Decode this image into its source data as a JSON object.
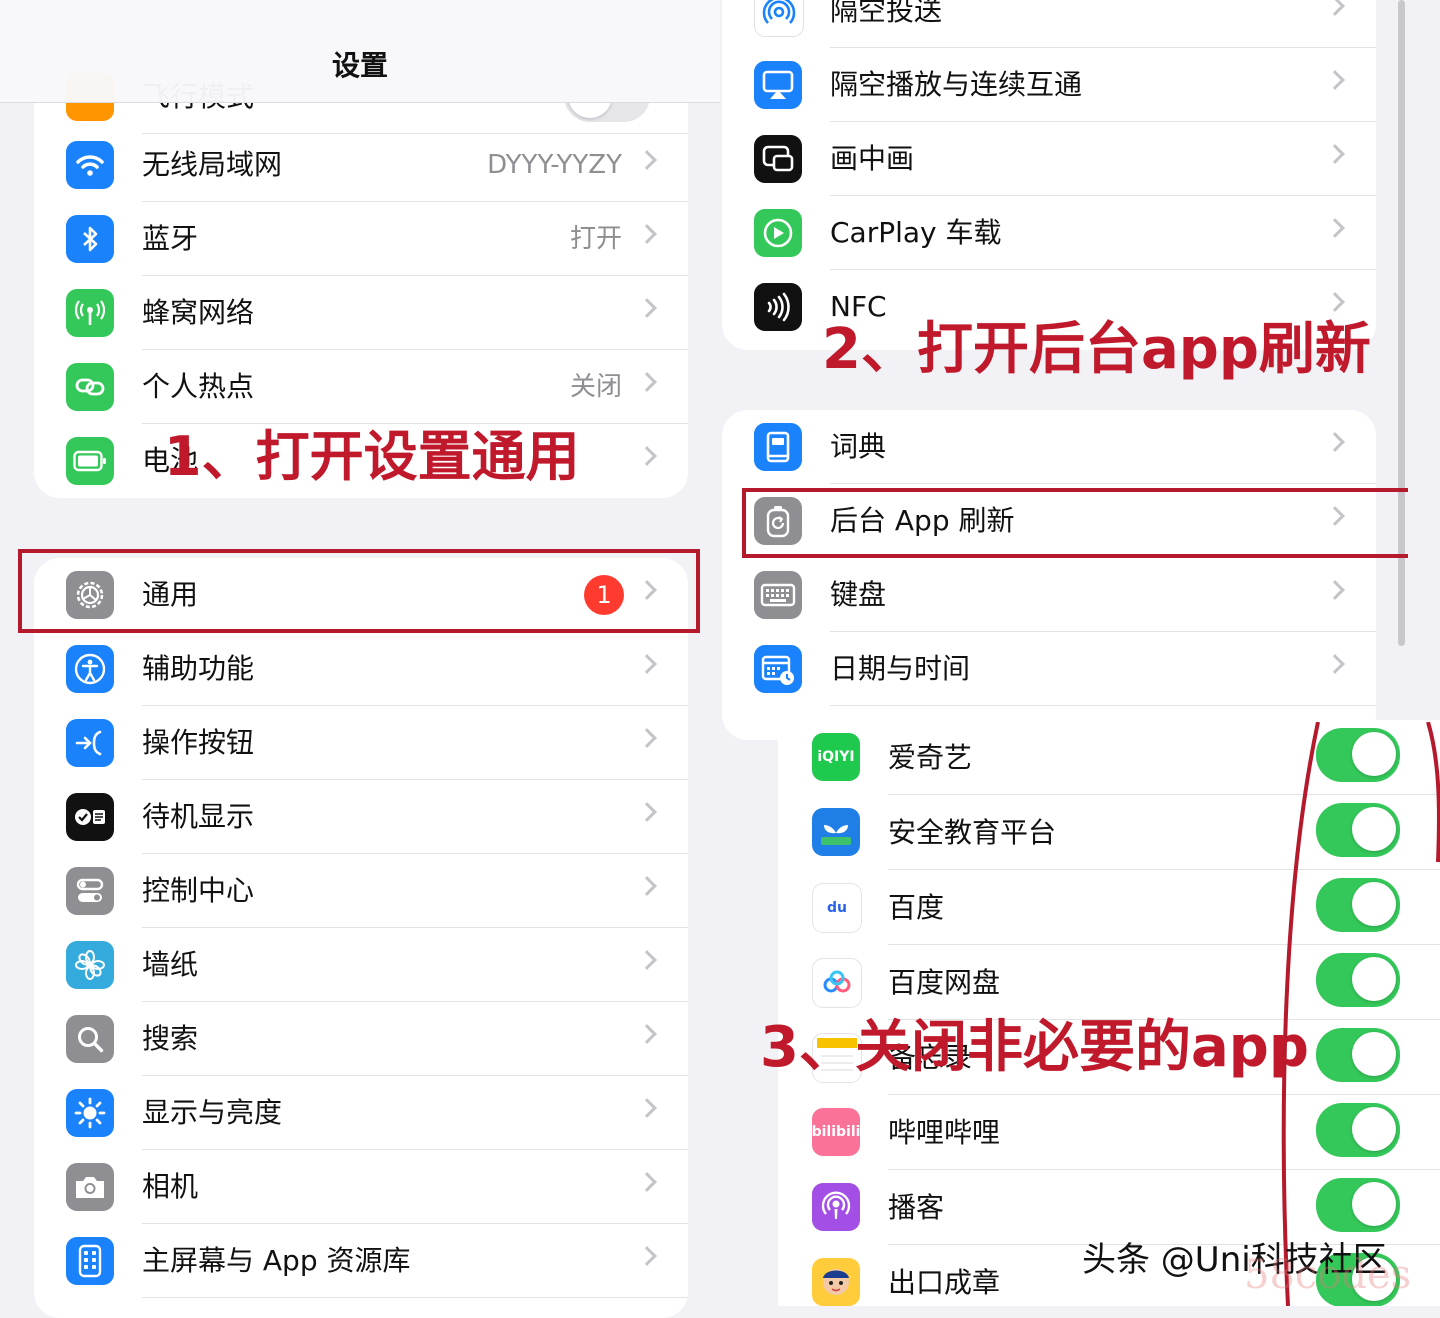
{
  "header": {
    "title": "设置"
  },
  "left": {
    "top_partial": {
      "label": "飞行模式"
    },
    "group1": [
      {
        "label": "无线局域网",
        "value": "DYYY-YYZY",
        "icon": "wifi-icon",
        "color": "#1a82fb"
      },
      {
        "label": "蓝牙",
        "value": "打开",
        "icon": "bluetooth-icon",
        "color": "#1a82fb"
      },
      {
        "label": "蜂窝网络",
        "value": "",
        "icon": "antenna-icon",
        "color": "#34c759"
      },
      {
        "label": "个人热点",
        "value": "关闭",
        "icon": "link-icon",
        "color": "#34c759"
      },
      {
        "label": "电池",
        "value": "",
        "icon": "battery-icon",
        "color": "#34c759"
      }
    ],
    "group2": [
      {
        "label": "通用",
        "badge": "1",
        "icon": "gear-icon",
        "color": "#8e8e93"
      },
      {
        "label": "辅助功能",
        "icon": "accessibility-icon",
        "color": "#1a82fb"
      },
      {
        "label": "操作按钮",
        "icon": "action-button-icon",
        "color": "#1a82fb"
      },
      {
        "label": "待机显示",
        "icon": "standby-icon",
        "color": "#111111"
      },
      {
        "label": "控制中心",
        "icon": "control-center-icon",
        "color": "#8e8e93"
      },
      {
        "label": "墙纸",
        "icon": "flower-icon",
        "color": "#35aadc"
      },
      {
        "label": "搜索",
        "icon": "search-icon",
        "color": "#8e8e93"
      },
      {
        "label": "显示与亮度",
        "icon": "brightness-icon",
        "color": "#1a82fb"
      },
      {
        "label": "相机",
        "icon": "camera-icon",
        "color": "#8e8e93"
      },
      {
        "label": "主屏幕与 App 资源库",
        "icon": "home-screen-icon",
        "color": "#1a82fb"
      }
    ]
  },
  "right": {
    "group1": [
      {
        "label": "隔空投送",
        "icon": "airdrop-icon",
        "color": "#ffffff"
      },
      {
        "label": "隔空播放与连续互通",
        "icon": "airplay-icon",
        "color": "#1a82fb"
      },
      {
        "label": "画中画",
        "icon": "pip-icon",
        "color": "#111111"
      },
      {
        "label": "CarPlay 车载",
        "icon": "carplay-icon",
        "color": "#34c759"
      },
      {
        "label": "NFC",
        "icon": "nfc-icon",
        "color": "#111111"
      }
    ],
    "group2": [
      {
        "label": "词典",
        "icon": "dictionary-icon",
        "color": "#1a82fb"
      },
      {
        "label": "后台 App 刷新",
        "icon": "refresh-icon",
        "color": "#8e8e93"
      },
      {
        "label": "键盘",
        "icon": "keyboard-icon",
        "color": "#8e8e93"
      },
      {
        "label": "日期与时间",
        "icon": "calendar-icon",
        "color": "#1a82fb"
      }
    ],
    "apps": [
      {
        "label": "爱奇艺",
        "on": true,
        "icon": "iqiyi-icon",
        "icon_text": "iQIYI"
      },
      {
        "label": "安全教育平台",
        "on": true,
        "icon": "safety-edu-icon"
      },
      {
        "label": "百度",
        "on": true,
        "icon": "baidu-icon",
        "icon_text": "du"
      },
      {
        "label": "百度网盘",
        "on": true,
        "icon": "baidu-netdisk-icon"
      },
      {
        "label": "备忘录",
        "on": true,
        "icon": "notes-icon"
      },
      {
        "label": "哔哩哔哩",
        "on": true,
        "icon": "bilibili-icon",
        "icon_text": "bilibili"
      },
      {
        "label": "播客",
        "on": true,
        "icon": "podcasts-icon"
      },
      {
        "label": "出口成章",
        "on": true,
        "icon": "chukouchengzhang-icon"
      }
    ]
  },
  "annotations": {
    "step1": "1、打开设置通用",
    "step2": "2、打开后台app刷新",
    "step3": "3、关闭非必要的app"
  },
  "watermark": {
    "text": "头条 @Uni科技社区",
    "faint": "58codes"
  },
  "colors": {
    "accent_red": "#c0192b",
    "toggle_on": "#34c759",
    "badge": "#ff3b30"
  }
}
